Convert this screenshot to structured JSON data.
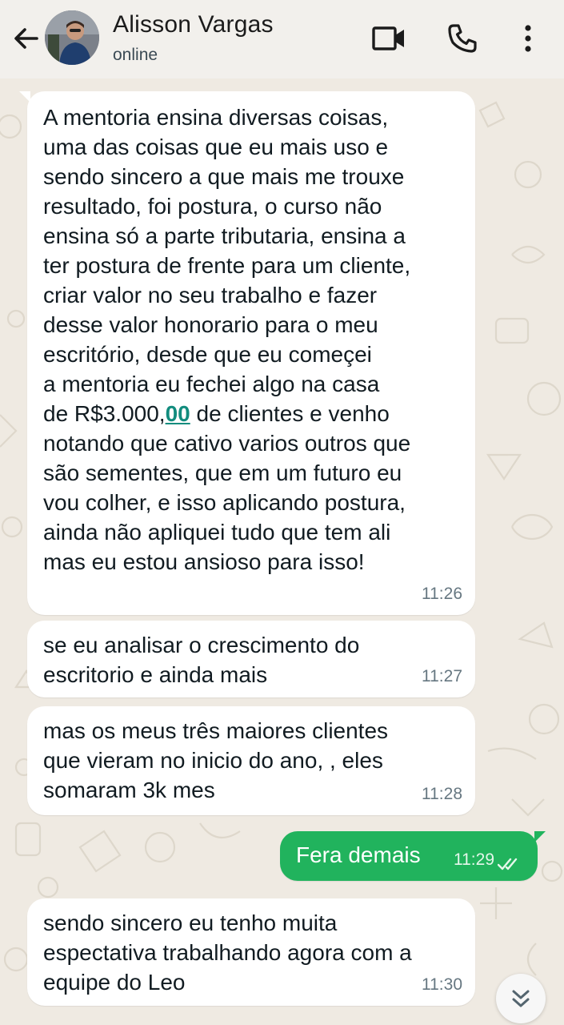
{
  "header": {
    "contact_name": "Alisson Vargas",
    "status": "online",
    "icons": [
      "back-arrow-icon",
      "video-call-icon",
      "phone-icon",
      "more-options-icon"
    ]
  },
  "messages": [
    {
      "direction": "incoming",
      "text_before": "A mentoria ensina diversas coisas,\numa das coisas que eu mais uso e\nsendo sincero a que mais me trouxe\nresultado, foi postura, o curso não\nensina só a parte tributaria, ensina a\nter postura de frente para um cliente,\ncriar valor no seu trabalho e fazer\ndesse valor honorario para o meu\nescritório, desde que eu começei\na mentoria eu fechei algo na casa\nde R$3.000,",
      "text_link": "00",
      "text_after": " de clientes e venho\nnotando que cativo varios outros que\nsão sementes, que em um futuro eu\nvou colher, e isso aplicando postura,\nainda não apliquei tudo que tem ali\nmas eu estou ansioso para isso!",
      "time": "11:26"
    },
    {
      "direction": "incoming",
      "text": "se eu analisar o crescimento do\nescritorio e ainda mais",
      "time": "11:27"
    },
    {
      "direction": "incoming",
      "text": "mas os meus três maiores clientes\nque vieram no inicio do ano, , eles\nsomaram 3k mes",
      "time": "11:28"
    },
    {
      "direction": "outgoing",
      "text": "Fera demais",
      "time": "11:29",
      "read": true
    },
    {
      "direction": "incoming",
      "text": "sendo sincero eu tenho muita\nespectativa trabalhando agora com a\nequipe do Leo",
      "time": "11:30"
    }
  ],
  "colors": {
    "header_bg": "#f2f0ec",
    "chat_bg": "#efeae2",
    "incoming_bubble": "#ffffff",
    "outgoing_bubble": "#21b35d",
    "link": "#128c7e"
  }
}
